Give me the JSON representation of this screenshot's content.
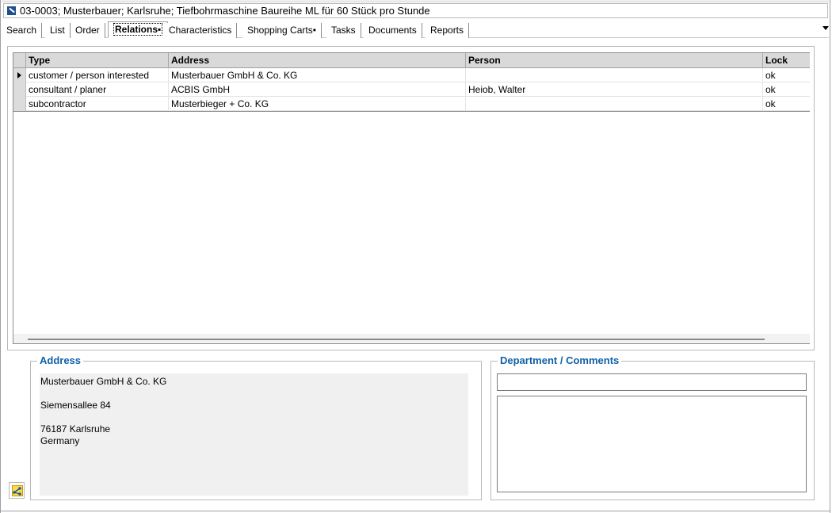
{
  "window": {
    "title": "03-0003; Musterbauer; Karlsruhe; Tiefbohrmaschine Baureihe ML für 60 Stück pro Stunde"
  },
  "tabs": [
    {
      "label": "Search"
    },
    {
      "label": "List"
    },
    {
      "label": "Order"
    },
    {
      "label": "Relations▪",
      "active": true
    },
    {
      "label": "Characteristics"
    },
    {
      "label": "Shopping Carts•"
    },
    {
      "label": "Tasks"
    },
    {
      "label": "Documents"
    },
    {
      "label": "Reports"
    }
  ],
  "grid": {
    "columns": [
      "Type",
      "Address",
      "Person",
      "Lock"
    ],
    "rows": [
      {
        "type": "customer / person interested",
        "address": "Musterbauer GmbH & Co. KG",
        "person": "",
        "lock": "ok",
        "current": true
      },
      {
        "type": "consultant / planer",
        "address": "ACBIS GmbH",
        "person": "Heiob, Walter",
        "lock": "ok"
      },
      {
        "type": "subcontractor",
        "address": "Musterbieger + Co. KG",
        "person": "",
        "lock": "ok"
      }
    ]
  },
  "address_panel": {
    "title": "Address",
    "lines": [
      "Musterbauer GmbH & Co. KG",
      "",
      "Siemensallee 84",
      "",
      "76187 Karlsruhe",
      "Germany"
    ]
  },
  "department_panel": {
    "title": "Department / Comments",
    "department": "",
    "comments": ""
  },
  "colors": {
    "group_title": "#1060a8",
    "header_bg": "#d9d9d9",
    "address_bg": "#f0f0f0"
  },
  "icons": {
    "title": "document-icon",
    "share": "share-icon",
    "tab_overflow": "chevron-down-icon",
    "row_pointer": "row-pointer-icon"
  }
}
